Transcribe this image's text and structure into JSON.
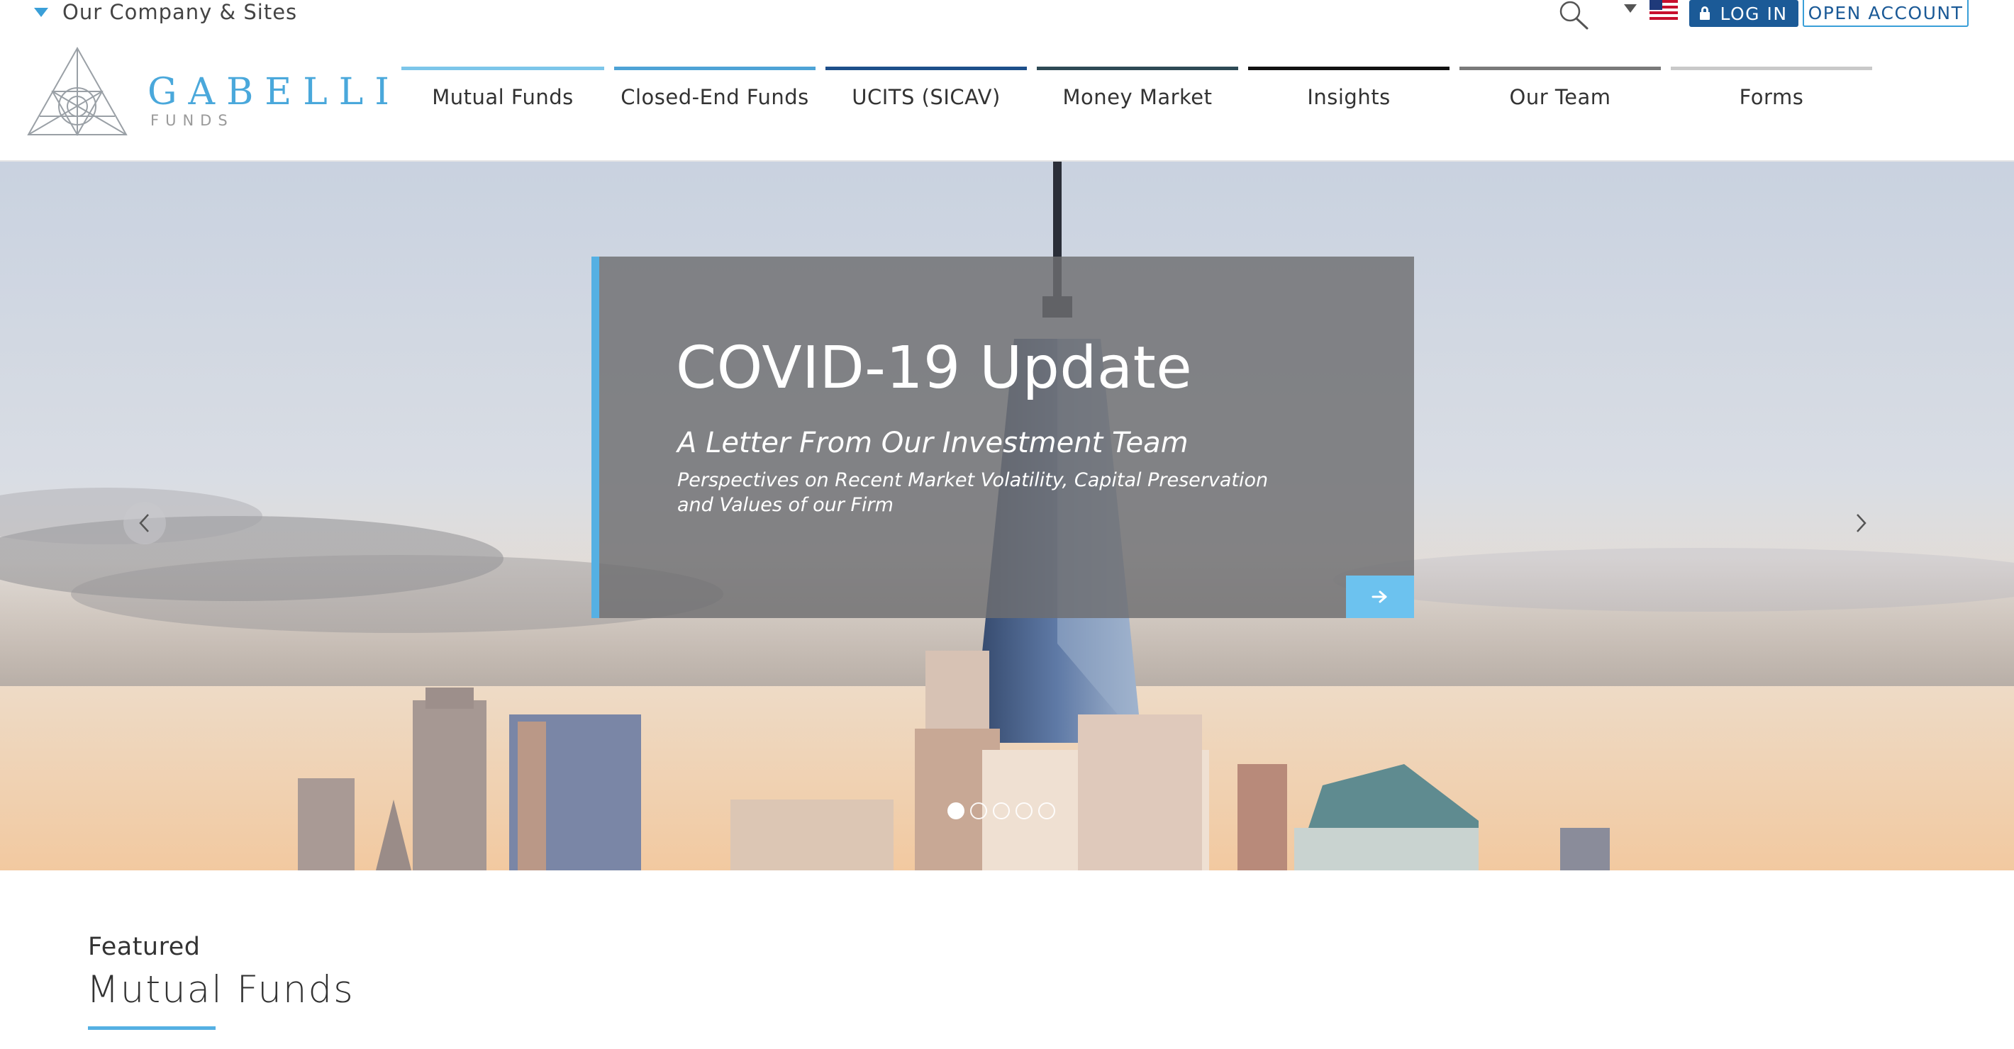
{
  "utility": {
    "company_sites_label": "Our Company & Sites",
    "login_label": "LOG IN",
    "open_account_label": "OPEN ACCOUNT",
    "search_icon": "search-icon",
    "flag_icon": "us-flag-icon"
  },
  "logo": {
    "name": "GABELLI",
    "sub": "FUNDS"
  },
  "nav": {
    "items": [
      {
        "label": "Mutual Funds",
        "accent": "#7cc6ea"
      },
      {
        "label": "Closed-End Funds",
        "accent": "#4ea3d6"
      },
      {
        "label": "UCITS (SICAV)",
        "accent": "#1d4f8a"
      },
      {
        "label": "Money Market",
        "accent": "#2e4a55"
      },
      {
        "label": "Insights",
        "accent": "#111111"
      },
      {
        "label": "Our Team",
        "accent": "#7a7a7a"
      },
      {
        "label": "Forms",
        "accent": "#c9c9c9"
      }
    ]
  },
  "hero": {
    "title": "COVID-19 Update",
    "subtitle": "A Letter From Our Investment Team",
    "description": "Perspectives on Recent Market Volatility, Capital Preservation and Values of our Firm",
    "slide_count": 5,
    "active_slide": 1
  },
  "featured": {
    "eyebrow": "Featured",
    "title": "Mutual Funds"
  },
  "colors": {
    "brand_blue": "#1b5a97",
    "accent_blue": "#55b0e3"
  }
}
